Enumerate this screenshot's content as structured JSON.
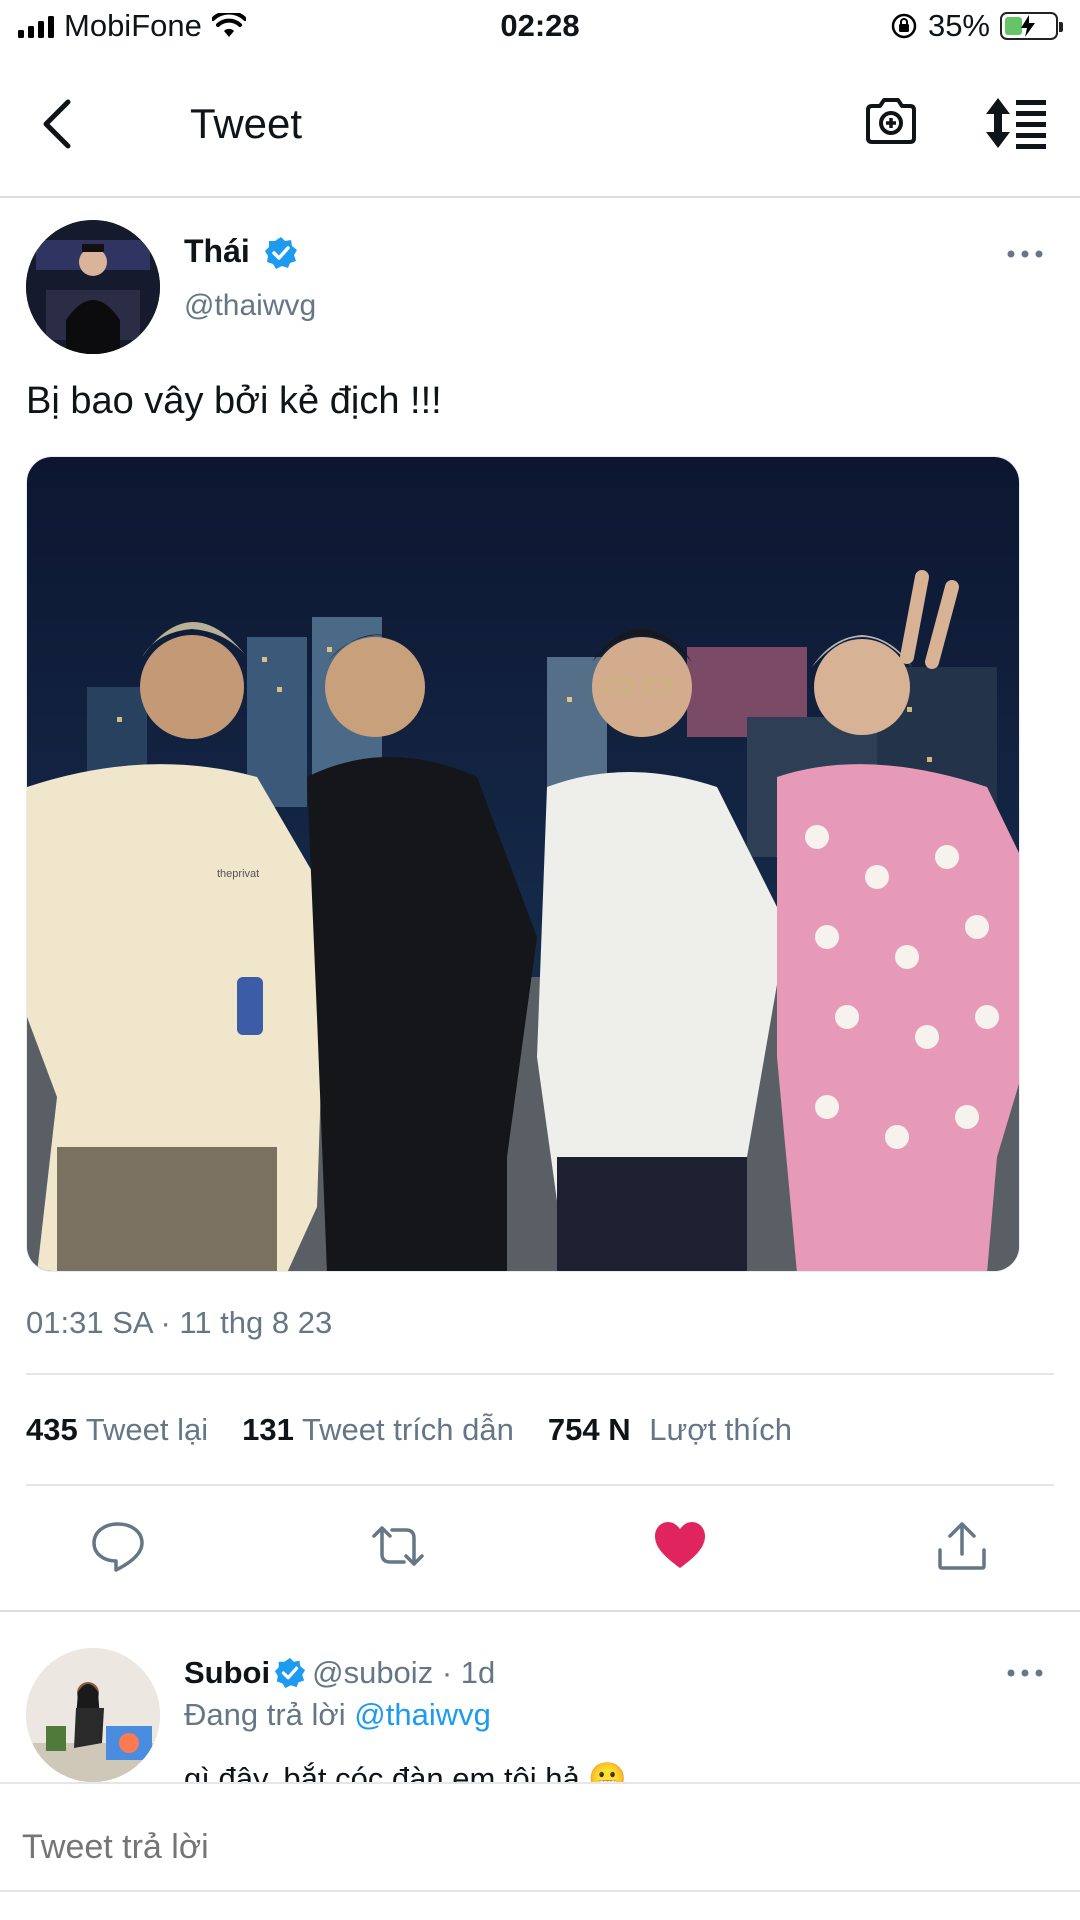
{
  "status_bar": {
    "carrier": "MobiFone",
    "time": "02:28",
    "battery_percent": "35%",
    "battery_level": 0.35,
    "icons": [
      "signal-icon",
      "wifi-icon",
      "rotation-lock-icon",
      "battery-charging-icon"
    ]
  },
  "nav": {
    "title": "Tweet",
    "back_icon": "chevron-left-icon",
    "camera_icon": "camera-add-icon",
    "sort_icon": "sort-icon"
  },
  "tweet": {
    "author_name": "Thái",
    "author_handle": "@thaiwvg",
    "text": "Bị bao vây bởi kẻ địch !!!",
    "photo_text": "theprivat",
    "timestamp": "01:31 SA · 11 thg 8 23",
    "stats": {
      "retweets_count": "435",
      "retweets_label": "Tweet lại",
      "quotes_count": "131",
      "quotes_label": "Tweet trích dẫn",
      "likes_count": "754 N",
      "likes_label": "Lượt thích"
    },
    "actions": [
      "reply-icon",
      "retweet-icon",
      "like-icon",
      "share-icon"
    ],
    "liked": true
  },
  "reply": {
    "author_name": "Suboi",
    "author_handle": "@suboiz",
    "age": "· 1d",
    "replying_prefix": "Đang trả lời",
    "replying_to": "@thaiwvg",
    "text": "gì đây, bắt cóc đàn em tôi hả 😬"
  },
  "compose": {
    "placeholder": "Tweet trả lời"
  },
  "colors": {
    "accent": "#1d9bf0",
    "like": "#f91880",
    "muted": "#657786"
  }
}
